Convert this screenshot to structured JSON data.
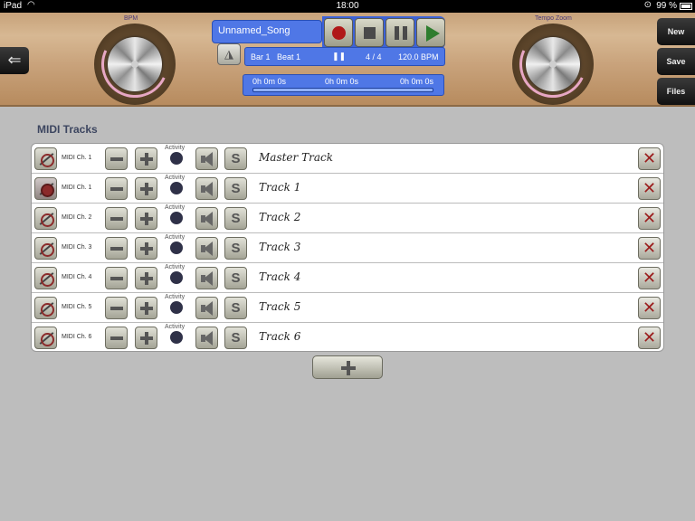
{
  "statusbar": {
    "device": "iPad",
    "time": "18:00",
    "battery": "99 %"
  },
  "knobs": {
    "left_label": "BPM",
    "right_label": "Tempo Zoom"
  },
  "song": {
    "name": "Unnamed_Song",
    "bar": "Bar 1",
    "beat": "Beat 1",
    "signature": "4 / 4",
    "bpm": "120.0 BPM"
  },
  "timeline": {
    "start": "0h 0m 0s",
    "position": "0h 0m 0s",
    "end": "0h 0m 0s"
  },
  "side_buttons": {
    "new": "New",
    "save": "Save",
    "files": "Files"
  },
  "section_title": "MIDI Tracks",
  "activity_label": "Activity",
  "solo_label": "S",
  "tracks": [
    {
      "channel": "MIDI Ch. 1",
      "name": "Master Track"
    },
    {
      "channel": "MIDI Ch. 1",
      "name": "Track 1"
    },
    {
      "channel": "MIDI Ch. 2",
      "name": "Track 2"
    },
    {
      "channel": "MIDI Ch. 3",
      "name": "Track 3"
    },
    {
      "channel": "MIDI Ch. 4",
      "name": "Track 4"
    },
    {
      "channel": "MIDI Ch. 5",
      "name": "Track 5"
    },
    {
      "channel": "MIDI Ch. 6",
      "name": "Track 6"
    }
  ],
  "colors": {
    "accent_blue": "#4f77e6",
    "record_red": "#b01818",
    "play_green": "#2e7d2e",
    "delete_red": "#9b1c1c"
  }
}
